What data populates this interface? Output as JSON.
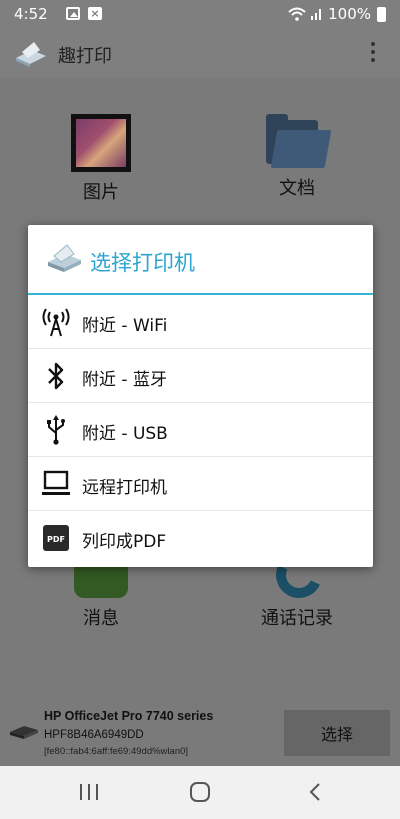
{
  "status_bar": {
    "time": "4:52",
    "battery": "100%"
  },
  "app_bar": {
    "title": "趣打印"
  },
  "tiles": {
    "photos": "图片",
    "documents": "文档",
    "messages": "消息",
    "call_log": "通话记录"
  },
  "dialog": {
    "title": "选择打印机",
    "options": [
      {
        "label": "附近 - WiFi",
        "icon": "wifi-antenna-icon"
      },
      {
        "label": "附近 - 蓝牙",
        "icon": "bluetooth-icon"
      },
      {
        "label": "附近 - USB",
        "icon": "usb-icon"
      },
      {
        "label": "远程打印机",
        "icon": "computer-icon"
      },
      {
        "label": "列印成PDF",
        "icon": "pdf-icon"
      }
    ],
    "accent_color": "#2ca6cf"
  },
  "printer_bar": {
    "name": "HP OfficeJet Pro 7740 series",
    "id": "HPF8B46A6949DD",
    "address": "[fe80::fab4:6aff:fe69:49dd%wlan0]",
    "select_label": "选择"
  }
}
